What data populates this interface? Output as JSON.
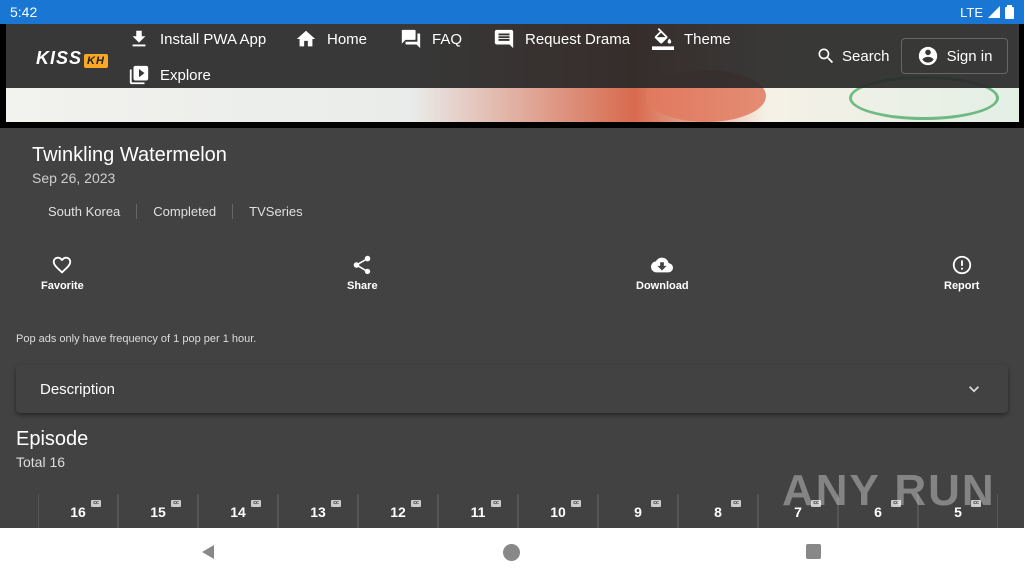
{
  "status": {
    "time": "5:42",
    "network": "LTE"
  },
  "header": {
    "logo": "KISS",
    "logo_badge": "KH",
    "nav": [
      {
        "label": "Install PWA App",
        "icon": "download-icon"
      },
      {
        "label": "Home",
        "icon": "home-icon"
      },
      {
        "label": "FAQ",
        "icon": "forum-icon"
      },
      {
        "label": "Request Drama",
        "icon": "comment-icon"
      },
      {
        "label": "Theme",
        "icon": "paint-bucket-icon"
      },
      {
        "label": "Explore",
        "icon": "video-library-icon"
      }
    ],
    "search_label": "Search",
    "signin_label": "Sign in"
  },
  "show": {
    "title": "Twinkling Watermelon",
    "date": "Sep 26, 2023",
    "chips": [
      "South Korea",
      "Completed",
      "TVSeries"
    ]
  },
  "actions": [
    {
      "label": "Favorite",
      "icon": "heart-icon"
    },
    {
      "label": "Share",
      "icon": "share-icon"
    },
    {
      "label": "Download",
      "icon": "cloud-download-icon"
    },
    {
      "label": "Report",
      "icon": "alert-circle-icon"
    }
  ],
  "pop_note": "Pop ads only have frequency of 1 pop per 1 hour.",
  "description": {
    "label": "Description"
  },
  "episodes": {
    "title": "Episode",
    "total": "Total 16",
    "list": [
      "16",
      "15",
      "14",
      "13",
      "12",
      "11",
      "10",
      "9",
      "8",
      "7",
      "6",
      "5"
    ],
    "cc_label": "cc"
  },
  "watermark": "ANY RUN"
}
